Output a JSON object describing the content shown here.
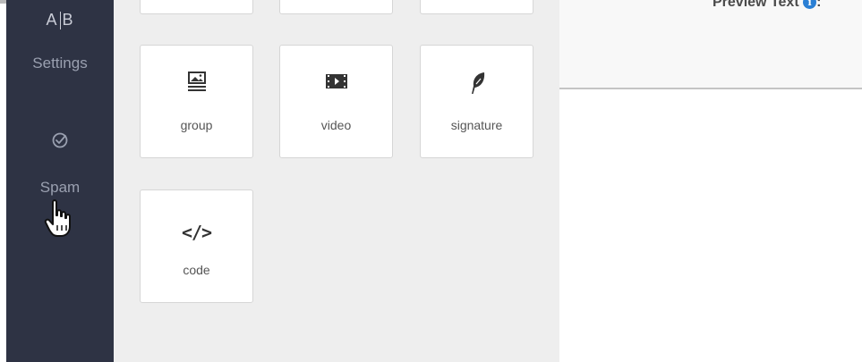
{
  "sidebar": {
    "ab_left": "A",
    "ab_right": "B",
    "settings_label": "Settings",
    "spam_label": "Spam"
  },
  "palette": {
    "tiles": [
      {
        "label": "group",
        "icon": "image-group-icon"
      },
      {
        "label": "video",
        "icon": "video-icon"
      },
      {
        "label": "signature",
        "icon": "feather-icon"
      },
      {
        "label": "code",
        "icon": "code-icon"
      }
    ],
    "code_glyph": "</>"
  },
  "editor": {
    "preview_text_label": "Preview Text",
    "info_glyph": "i",
    "colon": ":"
  },
  "colors": {
    "sidebar_bg": "#2e3344",
    "palette_bg": "#eeeeee",
    "info_blue": "#2a7fd4"
  }
}
